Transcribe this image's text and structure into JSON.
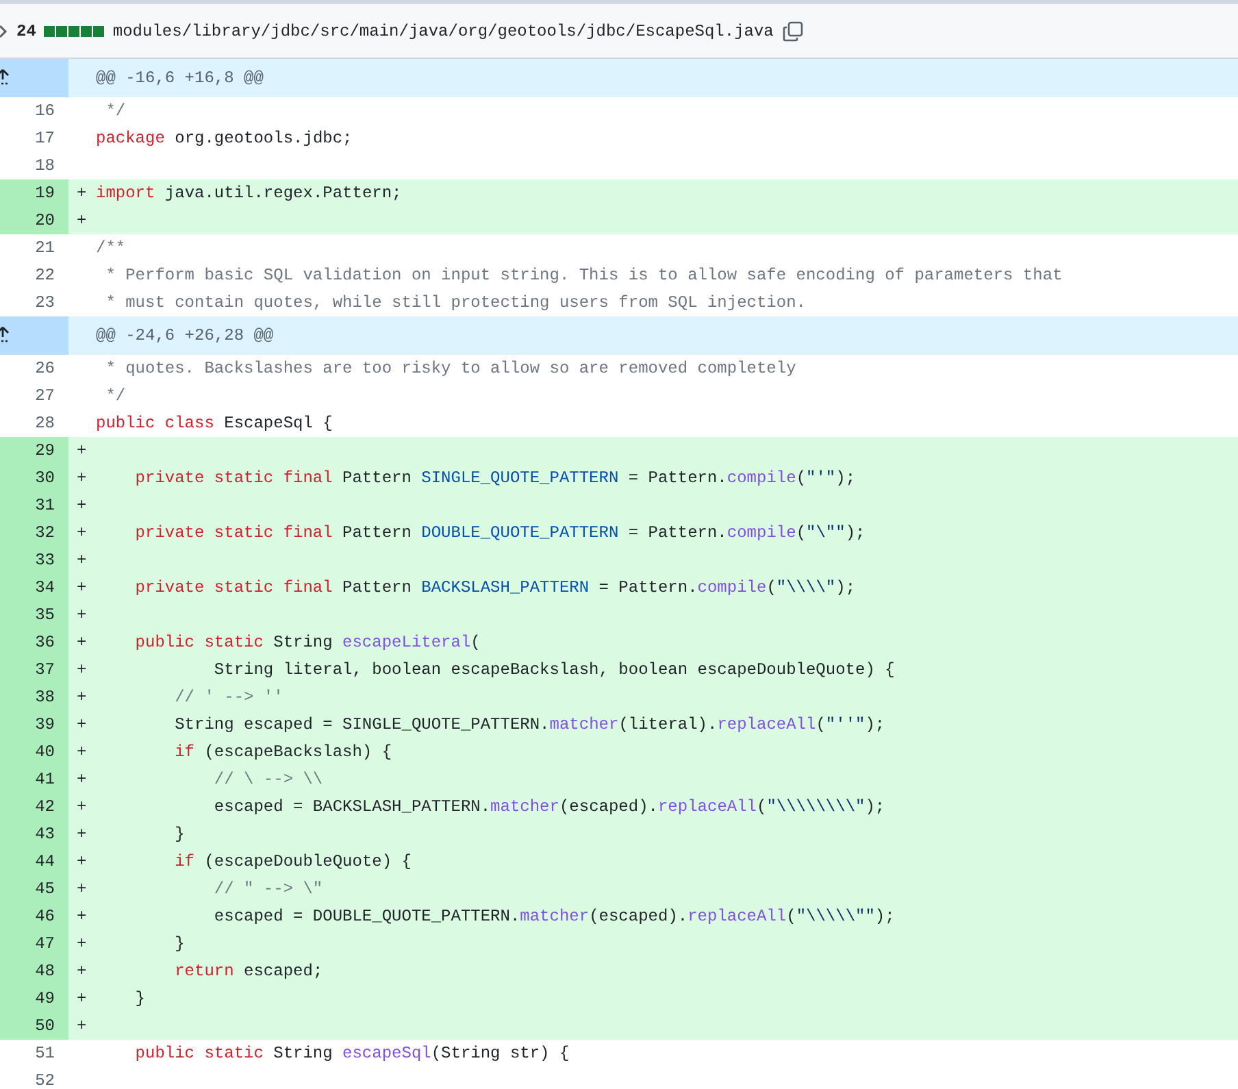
{
  "file_header": {
    "count": "24",
    "path": "modules/library/jdbc/src/main/java/org/geotools/jdbc/EscapeSql.java"
  },
  "rows": [
    {
      "kind": "hunk",
      "text": "@@ -16,6 +16,8 @@"
    },
    {
      "kind": "context",
      "num": "16",
      "tokens": [
        {
          "kind": "comment",
          "text": " */"
        }
      ]
    },
    {
      "kind": "context",
      "num": "17",
      "tokens": [
        {
          "kind": "keyword",
          "text": "package"
        },
        {
          "kind": "plain",
          "text": " org.geotools.jdbc;"
        }
      ]
    },
    {
      "kind": "context",
      "num": "18",
      "tokens": []
    },
    {
      "kind": "added",
      "num": "19",
      "marker": "+",
      "tokens": [
        {
          "kind": "keyword",
          "text": "import"
        },
        {
          "kind": "plain",
          "text": " java.util.regex.Pattern;"
        }
      ]
    },
    {
      "kind": "added",
      "num": "20",
      "marker": "+",
      "tokens": []
    },
    {
      "kind": "context",
      "num": "21",
      "tokens": [
        {
          "kind": "comment",
          "text": "/**"
        }
      ]
    },
    {
      "kind": "context",
      "num": "22",
      "tokens": [
        {
          "kind": "comment",
          "text": " * Perform basic SQL validation on input string. This is to allow safe encoding of parameters that"
        }
      ]
    },
    {
      "kind": "context",
      "num": "23",
      "tokens": [
        {
          "kind": "comment",
          "text": " * must contain quotes, while still protecting users from SQL injection."
        }
      ]
    },
    {
      "kind": "hunk",
      "text": "@@ -24,6 +26,28 @@"
    },
    {
      "kind": "context",
      "num": "26",
      "tokens": [
        {
          "kind": "comment",
          "text": " * quotes. Backslashes are too risky to allow so are removed completely"
        }
      ]
    },
    {
      "kind": "context",
      "num": "27",
      "tokens": [
        {
          "kind": "comment",
          "text": " */"
        }
      ]
    },
    {
      "kind": "context",
      "num": "28",
      "tokens": [
        {
          "kind": "keyword",
          "text": "public class"
        },
        {
          "kind": "plain",
          "text": " EscapeSql {"
        }
      ]
    },
    {
      "kind": "added",
      "num": "29",
      "marker": "+",
      "tokens": []
    },
    {
      "kind": "added",
      "num": "30",
      "marker": "+",
      "tokens": [
        {
          "kind": "keyword",
          "text": "    private static final"
        },
        {
          "kind": "plain",
          "text": " Pattern "
        },
        {
          "kind": "constant",
          "text": "SINGLE_QUOTE_PATTERN"
        },
        {
          "kind": "plain",
          "text": " = Pattern."
        },
        {
          "kind": "function",
          "text": "compile"
        },
        {
          "kind": "plain",
          "text": "("
        },
        {
          "kind": "string",
          "text": "\"'\""
        },
        {
          "kind": "plain",
          "text": ");"
        }
      ]
    },
    {
      "kind": "added",
      "num": "31",
      "marker": "+",
      "tokens": []
    },
    {
      "kind": "added",
      "num": "32",
      "marker": "+",
      "tokens": [
        {
          "kind": "keyword",
          "text": "    private static final"
        },
        {
          "kind": "plain",
          "text": " Pattern "
        },
        {
          "kind": "constant",
          "text": "DOUBLE_QUOTE_PATTERN"
        },
        {
          "kind": "plain",
          "text": " = Pattern."
        },
        {
          "kind": "function",
          "text": "compile"
        },
        {
          "kind": "plain",
          "text": "("
        },
        {
          "kind": "string",
          "text": "\"\\\"\""
        },
        {
          "kind": "plain",
          "text": ");"
        }
      ]
    },
    {
      "kind": "added",
      "num": "33",
      "marker": "+",
      "tokens": []
    },
    {
      "kind": "added",
      "num": "34",
      "marker": "+",
      "tokens": [
        {
          "kind": "keyword",
          "text": "    private static final"
        },
        {
          "kind": "plain",
          "text": " Pattern "
        },
        {
          "kind": "constant",
          "text": "BACKSLASH_PATTERN"
        },
        {
          "kind": "plain",
          "text": " = Pattern."
        },
        {
          "kind": "function",
          "text": "compile"
        },
        {
          "kind": "plain",
          "text": "("
        },
        {
          "kind": "string",
          "text": "\"\\\\\\\\\""
        },
        {
          "kind": "plain",
          "text": ");"
        }
      ]
    },
    {
      "kind": "added",
      "num": "35",
      "marker": "+",
      "tokens": []
    },
    {
      "kind": "added",
      "num": "36",
      "marker": "+",
      "tokens": [
        {
          "kind": "keyword",
          "text": "    public static"
        },
        {
          "kind": "plain",
          "text": " String "
        },
        {
          "kind": "function",
          "text": "escapeLiteral"
        },
        {
          "kind": "plain",
          "text": "("
        }
      ]
    },
    {
      "kind": "added",
      "num": "37",
      "marker": "+",
      "tokens": [
        {
          "kind": "plain",
          "text": "            String literal, boolean escapeBackslash, boolean escapeDoubleQuote) {"
        }
      ]
    },
    {
      "kind": "added",
      "num": "38",
      "marker": "+",
      "tokens": [
        {
          "kind": "comment",
          "text": "        // ' --> ''"
        }
      ]
    },
    {
      "kind": "added",
      "num": "39",
      "marker": "+",
      "tokens": [
        {
          "kind": "plain",
          "text": "        String escaped = SINGLE_QUOTE_PATTERN."
        },
        {
          "kind": "function",
          "text": "matcher"
        },
        {
          "kind": "plain",
          "text": "(literal)."
        },
        {
          "kind": "function",
          "text": "replaceAll"
        },
        {
          "kind": "plain",
          "text": "("
        },
        {
          "kind": "string",
          "text": "\"''\""
        },
        {
          "kind": "plain",
          "text": ");"
        }
      ]
    },
    {
      "kind": "added",
      "num": "40",
      "marker": "+",
      "tokens": [
        {
          "kind": "keyword",
          "text": "        if"
        },
        {
          "kind": "plain",
          "text": " (escapeBackslash) {"
        }
      ]
    },
    {
      "kind": "added",
      "num": "41",
      "marker": "+",
      "tokens": [
        {
          "kind": "comment",
          "text": "            // \\ --> \\\\"
        }
      ]
    },
    {
      "kind": "added",
      "num": "42",
      "marker": "+",
      "tokens": [
        {
          "kind": "plain",
          "text": "            escaped = BACKSLASH_PATTERN."
        },
        {
          "kind": "function",
          "text": "matcher"
        },
        {
          "kind": "plain",
          "text": "(escaped)."
        },
        {
          "kind": "function",
          "text": "replaceAll"
        },
        {
          "kind": "plain",
          "text": "("
        },
        {
          "kind": "string",
          "text": "\"\\\\\\\\\\\\\\\\\""
        },
        {
          "kind": "plain",
          "text": ");"
        }
      ]
    },
    {
      "kind": "added",
      "num": "43",
      "marker": "+",
      "tokens": [
        {
          "kind": "plain",
          "text": "        }"
        }
      ]
    },
    {
      "kind": "added",
      "num": "44",
      "marker": "+",
      "tokens": [
        {
          "kind": "keyword",
          "text": "        if"
        },
        {
          "kind": "plain",
          "text": " (escapeDoubleQuote) {"
        }
      ]
    },
    {
      "kind": "added",
      "num": "45",
      "marker": "+",
      "tokens": [
        {
          "kind": "comment",
          "text": "            // \" --> \\\""
        }
      ]
    },
    {
      "kind": "added",
      "num": "46",
      "marker": "+",
      "tokens": [
        {
          "kind": "plain",
          "text": "            escaped = DOUBLE_QUOTE_PATTERN."
        },
        {
          "kind": "function",
          "text": "matcher"
        },
        {
          "kind": "plain",
          "text": "(escaped)."
        },
        {
          "kind": "function",
          "text": "replaceAll"
        },
        {
          "kind": "plain",
          "text": "("
        },
        {
          "kind": "string",
          "text": "\"\\\\\\\\\\\"\""
        },
        {
          "kind": "plain",
          "text": ");"
        }
      ]
    },
    {
      "kind": "added",
      "num": "47",
      "marker": "+",
      "tokens": [
        {
          "kind": "plain",
          "text": "        }"
        }
      ]
    },
    {
      "kind": "added",
      "num": "48",
      "marker": "+",
      "tokens": [
        {
          "kind": "keyword",
          "text": "        return"
        },
        {
          "kind": "plain",
          "text": " escaped;"
        }
      ]
    },
    {
      "kind": "added",
      "num": "49",
      "marker": "+",
      "tokens": [
        {
          "kind": "plain",
          "text": "    }"
        }
      ]
    },
    {
      "kind": "added",
      "num": "50",
      "marker": "+",
      "tokens": []
    },
    {
      "kind": "context",
      "num": "51",
      "tokens": [
        {
          "kind": "keyword",
          "text": "    public static"
        },
        {
          "kind": "plain",
          "text": " String "
        },
        {
          "kind": "function",
          "text": "escapeSql"
        },
        {
          "kind": "plain",
          "text": "(String str) {"
        }
      ]
    },
    {
      "kind": "context",
      "num": "52",
      "tokens": []
    }
  ]
}
